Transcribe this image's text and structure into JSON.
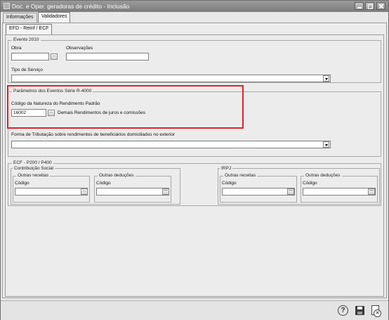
{
  "window": {
    "title": "Doc. e Oper. geradoras de crédito - Inclusão"
  },
  "tabs": [
    "Informações",
    "Validadores"
  ],
  "subtab": "EFD - Reinf / ECF",
  "evento2010": {
    "title": "Evento 2010",
    "obra_label": "Obra",
    "obra_value": "",
    "observacoes_label": "Observações",
    "observacoes_value": "",
    "tipo_servico_label": "Tipo de Serviço",
    "tipo_servico_value": ""
  },
  "r4000": {
    "title": "Parâmetros dos Eventos Série R-4000",
    "codigo_label": "Código da Natureza do Rendimento Padrão",
    "codigo_value": "16002",
    "codigo_desc": "Demais Rendimentos de juros e comissões",
    "forma_label": "Forma de Tributação sobre rendimentos de beneficiários domiciliados no exterior",
    "forma_value": ""
  },
  "ecf": {
    "title": "ECF - P200 / P400",
    "cs_title": "Contribuição Social",
    "irpj_title": "IRPJ",
    "outras_receitas": "Outras receitas",
    "outras_deducoes": "Outras deduções",
    "codigo": "Código"
  },
  "icons": [
    "help-icon",
    "save-icon",
    "cancel-icon"
  ],
  "colors": {
    "highlight": "#e0202a"
  }
}
